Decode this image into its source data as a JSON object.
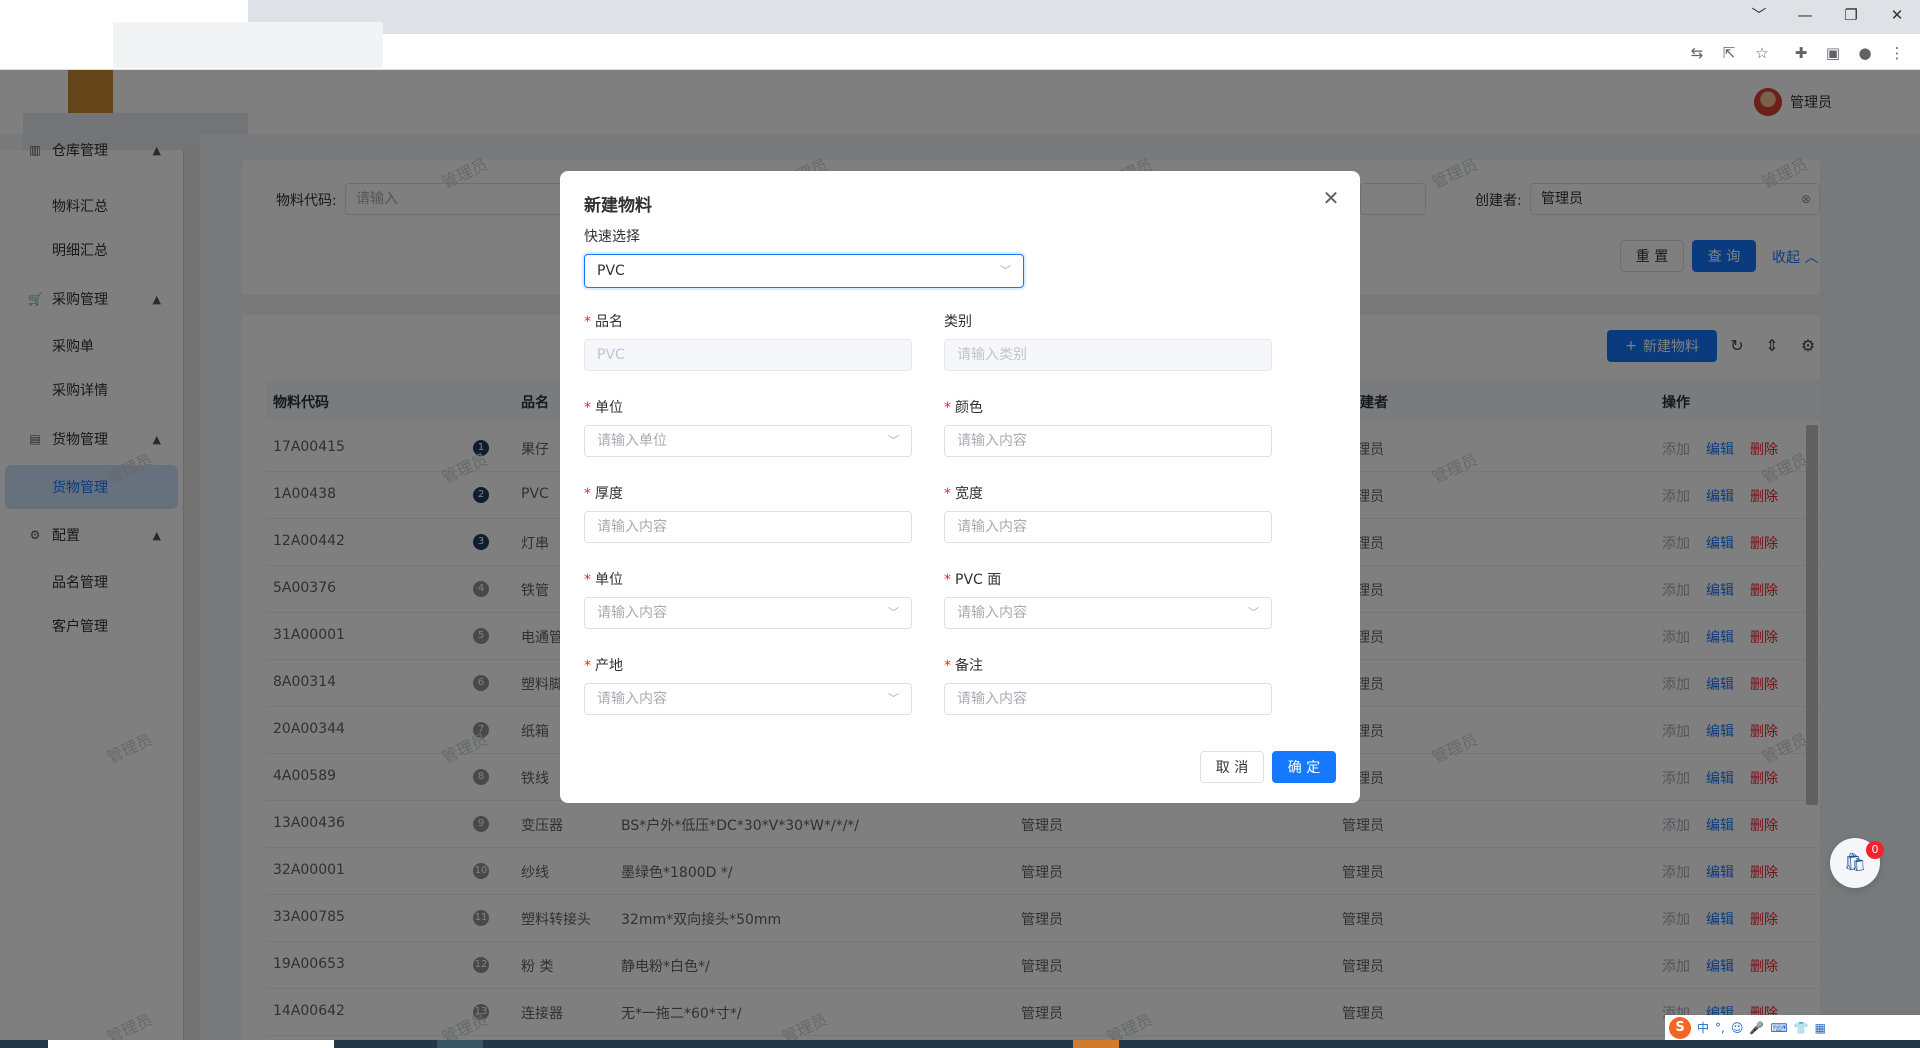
{
  "browser": {
    "window_controls": [
      "﹀",
      "—",
      "❐",
      "✕"
    ],
    "toolbar_icons": [
      "translate-icon",
      "share-icon",
      "star-icon",
      "extensions-icon",
      "sidepanel-icon",
      "profile-icon",
      "menu-icon"
    ]
  },
  "header": {
    "user_name": "管理员"
  },
  "sidebar": {
    "partial_group": "仓库管理",
    "items": [
      {
        "label": "物料汇总"
      },
      {
        "label": "明细汇总"
      }
    ],
    "groups": [
      {
        "label": "采购管理",
        "items": [
          "采购单",
          "采购详情"
        ]
      },
      {
        "label": "货物管理",
        "items": [
          "货物管理"
        ]
      },
      {
        "label": "配置",
        "items": [
          "品名管理",
          "客户管理"
        ]
      }
    ]
  },
  "search": {
    "code_label": "物料代码:",
    "code_placeholder": "请输入",
    "creator_label": "创建者:",
    "creator_value": "管理员",
    "reset_label": "重 置",
    "query_label": "查 询",
    "collapse_label": "收起"
  },
  "table": {
    "new_button": "新建物料",
    "columns": {
      "code": "物料代码",
      "name": "品名",
      "creator_short": "建者",
      "actions": "操作"
    },
    "action_labels": {
      "add": "添加",
      "edit": "编辑",
      "delete": "删除"
    },
    "rows": [
      {
        "index": "1",
        "code": "17A00415",
        "name": "果仔",
        "spec": "",
        "creator": "",
        "editor": "管理员"
      },
      {
        "index": "2",
        "code": "1A00438",
        "name": "PVC",
        "spec": "",
        "creator": "",
        "editor": "管理员"
      },
      {
        "index": "3",
        "code": "12A00442",
        "name": "灯串",
        "spec": "",
        "creator": "",
        "editor": "管理员"
      },
      {
        "index": "4",
        "code": "5A00376",
        "name": "铁管",
        "spec": "",
        "creator": "",
        "editor": "管理员"
      },
      {
        "index": "5",
        "code": "31A00001",
        "name": "电通管",
        "spec": "",
        "creator": "",
        "editor": "管理员"
      },
      {
        "index": "6",
        "code": "8A00314",
        "name": "塑料脚",
        "spec": "",
        "creator": "",
        "editor": "管理员"
      },
      {
        "index": "7",
        "code": "20A00344",
        "name": "纸箱",
        "spec": "",
        "creator": "",
        "editor": "管理员"
      },
      {
        "index": "8",
        "code": "4A00589",
        "name": "铁线",
        "spec": "",
        "creator": "",
        "editor": "管理员"
      },
      {
        "index": "9",
        "code": "13A00436",
        "name": "变压器",
        "spec": "BS*户外*低压*DC*30*V*30*W*/*/*/",
        "creator": "管理员",
        "editor": "管理员"
      },
      {
        "index": "10",
        "code": "32A00001",
        "name": "纱线",
        "spec": "墨绿色*1800D */",
        "creator": "管理员",
        "editor": "管理员"
      },
      {
        "index": "11",
        "code": "33A00785",
        "name": "塑料转接头",
        "spec": "32mm*双向接头*50mm",
        "creator": "管理员",
        "editor": "管理员"
      },
      {
        "index": "12",
        "code": "19A00653",
        "name": "粉 类",
        "spec": "静电粉*白色*/",
        "creator": "管理员",
        "editor": "管理员"
      },
      {
        "index": "13",
        "code": "14A00642",
        "name": "连接器",
        "spec": "无*一拖二*60*寸*/",
        "creator": "管理员",
        "editor": "管理员"
      }
    ]
  },
  "watermark_text": "管理员",
  "modal": {
    "title": "新建物料",
    "quick_select_label": "快速选择",
    "quick_select_value": "PVC",
    "fields": {
      "name": {
        "label": "品名",
        "value": "PVC",
        "required": true
      },
      "category": {
        "label": "类别",
        "placeholder": "请输入类别",
        "required": false
      },
      "unit": {
        "label": "单位",
        "placeholder": "请输入单位",
        "required": true
      },
      "color": {
        "label": "颜色",
        "placeholder": "请输入内容",
        "required": true
      },
      "thickness": {
        "label": "厚度",
        "placeholder": "请输入内容",
        "required": true
      },
      "width": {
        "label": "宽度",
        "placeholder": "请输入内容",
        "required": true
      },
      "unit2": {
        "label": "单位",
        "placeholder": "请输入内容",
        "required": true
      },
      "pvc_face": {
        "label": "PVC 面",
        "placeholder": "请输入内容",
        "required": true
      },
      "origin": {
        "label": "产地",
        "placeholder": "请输入内容",
        "required": true
      },
      "remark": {
        "label": "备注",
        "placeholder": "请输入内容",
        "required": true
      }
    },
    "cancel_label": "取 消",
    "confirm_label": "确 定"
  },
  "cart_count": "0",
  "ime": {
    "lang": "中"
  },
  "colors": {
    "primary": "#1677ff",
    "danger": "#f5222d",
    "overlay": "rgba(0,0,0,0.5)"
  }
}
